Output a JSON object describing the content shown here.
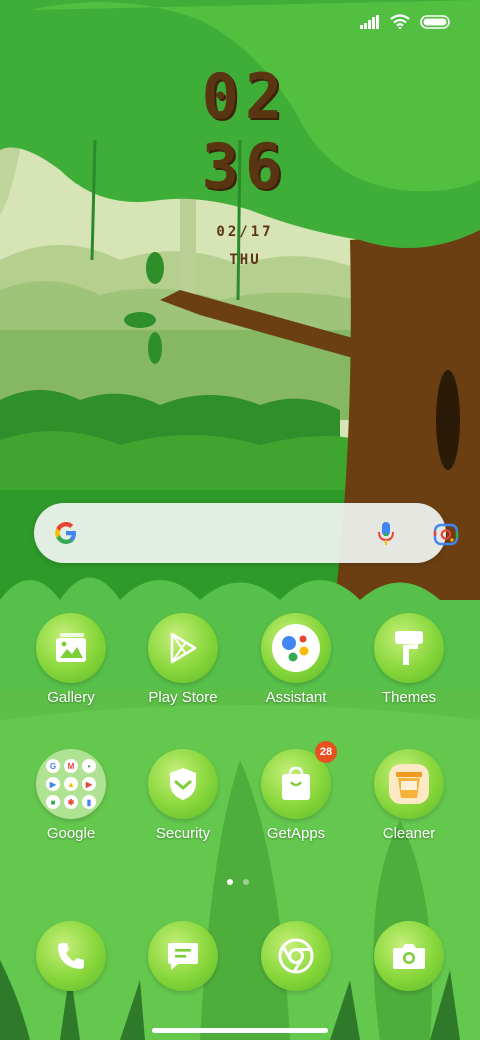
{
  "clock": {
    "hour": "02",
    "minute": "36",
    "date": "02/17",
    "day": "THU"
  },
  "search": {
    "icons": [
      "google-g-icon",
      "microphone-icon",
      "google-lens-icon"
    ]
  },
  "apps_row1": [
    {
      "label": "Gallery",
      "icon": "gallery-icon"
    },
    {
      "label": "Play Store",
      "icon": "play-store-icon"
    },
    {
      "label": "Assistant",
      "icon": "assistant-icon"
    },
    {
      "label": "Themes",
      "icon": "themes-icon"
    }
  ],
  "apps_row2": [
    {
      "label": "Google",
      "icon": "google-folder-icon"
    },
    {
      "label": "Security",
      "icon": "security-shield-icon"
    },
    {
      "label": "GetApps",
      "icon": "getapps-bag-icon",
      "badge": "28"
    },
    {
      "label": "Cleaner",
      "icon": "cleaner-icon"
    }
  ],
  "dock": [
    {
      "icon": "phone-icon"
    },
    {
      "icon": "messages-icon"
    },
    {
      "icon": "chrome-icon"
    },
    {
      "icon": "camera-icon"
    }
  ],
  "page_indicator": {
    "count": 2,
    "active": 1
  },
  "colors": {
    "trunk": "#5a3512",
    "badge": "#e8501f",
    "icon_bg": "#86d63a"
  }
}
